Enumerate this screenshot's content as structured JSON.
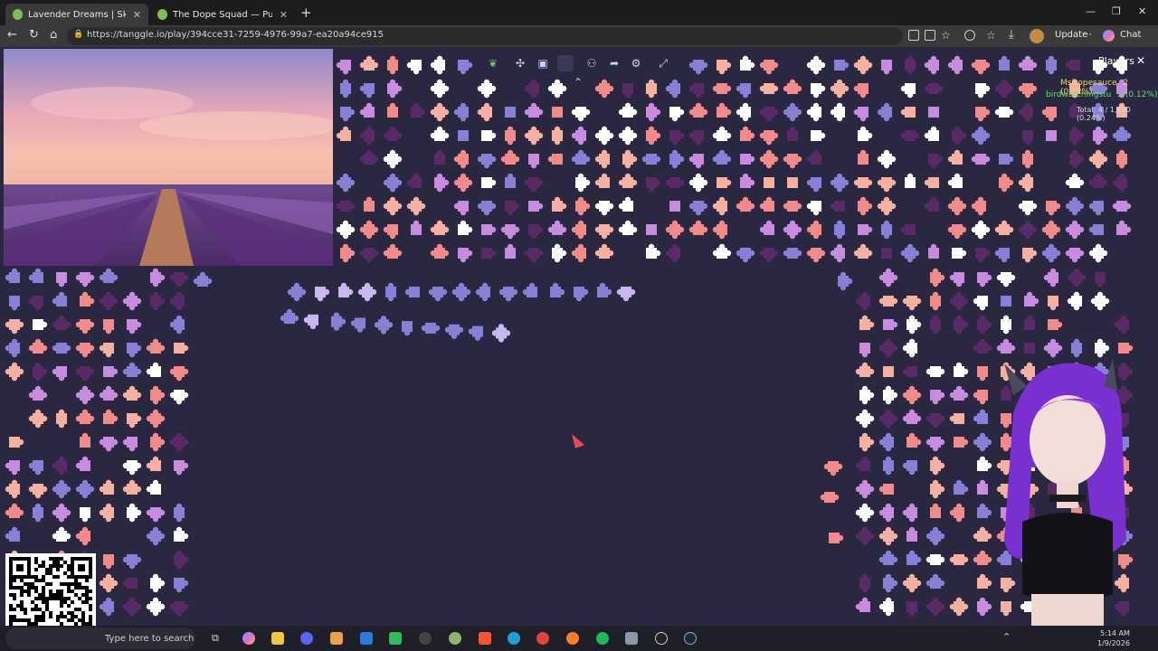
{
  "browser": {
    "tabs": [
      {
        "label": "Lavender Dreams | Sky Jigsaw",
        "active": true
      },
      {
        "label": "The Dope Squad — Puzzles",
        "active": false
      }
    ],
    "url": "https://tanggle.io/play/394cce31-7259-4976-99a7-ea20a94ce915",
    "update_label": "Update",
    "chat_label": "Chat",
    "window_controls": [
      "minimize-icon",
      "maximize-icon",
      "close-icon"
    ]
  },
  "game": {
    "toolbar_icons": [
      "leaf-icon",
      "puzzle-icon",
      "image-icon",
      "square-icon",
      "players-icon",
      "share-icon",
      "settings-icon",
      "fullscreen-icon",
      "collapse-icon"
    ],
    "players_panel": {
      "title": "Players",
      "players": [
        {
          "name": "MsDopesauce",
          "score": "2 (0.12%)",
          "color": "#f5d65c"
        },
        {
          "name": "birdwatchingstu",
          "score": "2 (0.12%)",
          "color": "#6ae06a"
        }
      ],
      "total": "Total: 4 / 1,650 (0.24%)"
    },
    "preview_alt_colors": [
      "#8f86c8",
      "#f3b1a6",
      "#6b3f8a"
    ],
    "piece_colors": [
      "#f28a8a",
      "#8a7fd6",
      "#ffffff",
      "#c98be0",
      "#5a2a66",
      "#f6b0a0"
    ]
  },
  "taskbar": {
    "search_placeholder": "Type here to search",
    "clock_time": "5:14 AM",
    "clock_date": "1/9/2026"
  }
}
